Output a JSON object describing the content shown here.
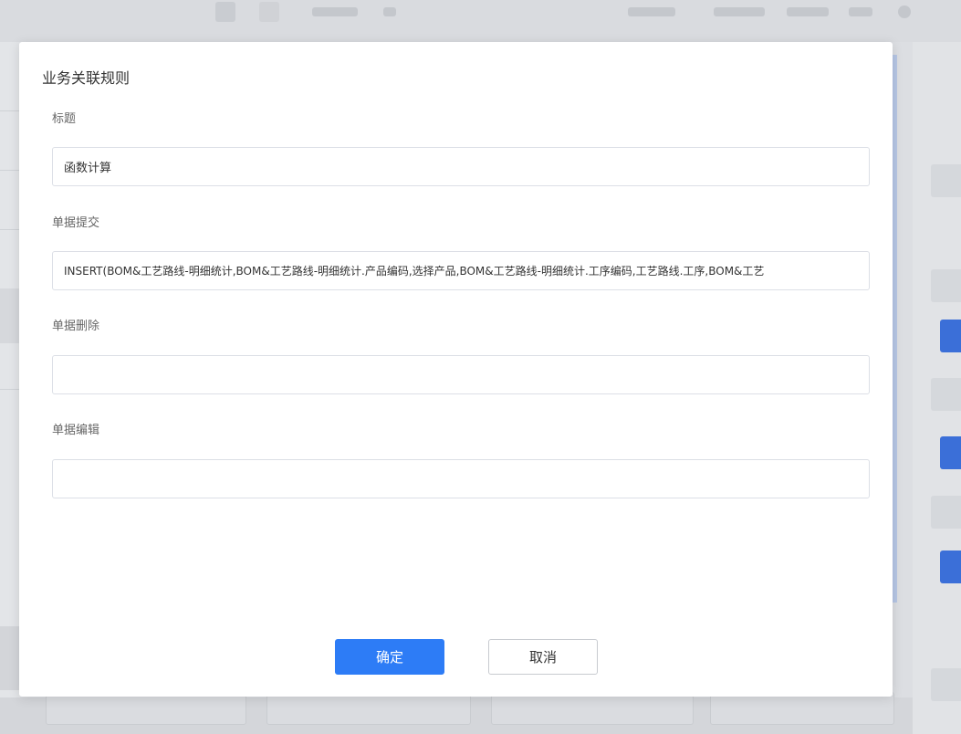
{
  "dialog": {
    "title": "业务关联规则",
    "fields": [
      {
        "label": "标题",
        "value": "函数计算",
        "placeholder": ""
      },
      {
        "label": "单据提交",
        "value": "INSERT(BOM&工艺路线-明细统计,BOM&工艺路线-明细统计.产品编码,选择产品,BOM&工艺路线-明细统计.工序编码,工艺路线.工序,BOM&工艺",
        "placeholder": ""
      },
      {
        "label": "单据删除",
        "value": "",
        "placeholder": ""
      },
      {
        "label": "单据编辑",
        "value": "",
        "placeholder": ""
      }
    ],
    "confirm_label": "确定",
    "cancel_label": "取消"
  },
  "colors": {
    "primary": "#2d7cf6",
    "overlay": "#d2d4d8"
  }
}
